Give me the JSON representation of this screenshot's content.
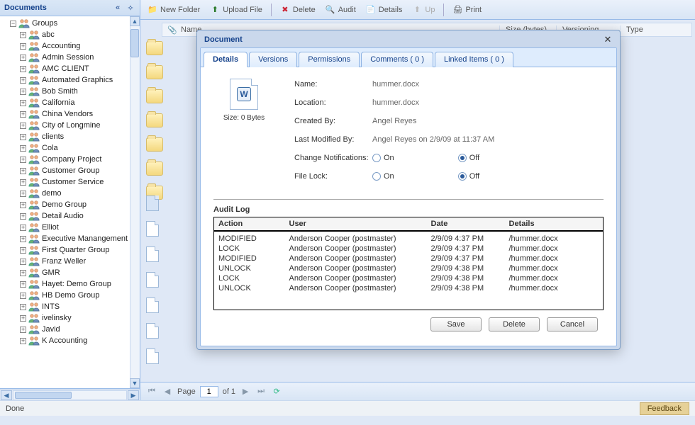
{
  "sidebar": {
    "title": "Documents",
    "root": "Groups",
    "items": [
      "abc",
      "Accounting",
      "Admin Session",
      "AMC CLIENT",
      "Automated Graphics",
      "Bob Smith",
      "California",
      "China Vendors",
      "City of Longmine",
      "clients",
      "Cola",
      "Company Project",
      "Customer Group",
      "Customer Service",
      "demo",
      "Demo Group",
      "Detail Audio",
      "Elliot",
      "Executive Manangement",
      "First Quarter Group",
      "Franz Weller",
      "GMR",
      "Hayet: Demo Group",
      "HB Demo Group",
      "INTS",
      "ivelinsky",
      "Javid",
      "K Accounting"
    ]
  },
  "toolbar": {
    "new_folder": "New Folder",
    "upload_file": "Upload File",
    "delete": "Delete",
    "audit": "Audit",
    "details": "Details",
    "up": "Up",
    "print": "Print"
  },
  "grid_headers": {
    "name": "Name",
    "size": "Size (bytes)",
    "versioning": "Versioning",
    "type": "Type"
  },
  "pager": {
    "page_label": "Page",
    "page_value": "1",
    "of_label": "of 1"
  },
  "status": {
    "done": "Done",
    "feedback": "Feedback"
  },
  "dialog": {
    "title": "Document",
    "tabs": {
      "details": "Details",
      "versions": "Versions",
      "permissions": "Permissions",
      "comments": "Comments ( 0 )",
      "linked": "Linked Items ( 0 )"
    },
    "size_label": "Size:",
    "size_value": "0 Bytes",
    "fields": {
      "name_label": "Name:",
      "name_value": "hummer.docx",
      "location_label": "Location:",
      "location_value": "hummer.docx",
      "created_label": "Created By:",
      "created_value": "Angel  Reyes",
      "modified_label": "Last Modified By:",
      "modified_value": "Angel  Reyes on 2/9/09 at 11:37 AM",
      "notify_label": "Change Notifications:",
      "lock_label": "File Lock:",
      "on": "On",
      "off": "Off"
    },
    "audit": {
      "heading": "Audit Log",
      "columns": {
        "action": "Action",
        "user": "User",
        "date": "Date",
        "details": "Details"
      },
      "rows": [
        {
          "action": "MODIFIED",
          "user": "Anderson Cooper (postmaster)",
          "date": "2/9/09 4:37 PM",
          "details": "/hummer.docx"
        },
        {
          "action": "LOCK",
          "user": "Anderson Cooper (postmaster)",
          "date": "2/9/09 4:37 PM",
          "details": "/hummer.docx"
        },
        {
          "action": "MODIFIED",
          "user": "Anderson Cooper (postmaster)",
          "date": "2/9/09 4:37 PM",
          "details": "/hummer.docx"
        },
        {
          "action": "UNLOCK",
          "user": "Anderson Cooper (postmaster)",
          "date": "2/9/09 4:38 PM",
          "details": "/hummer.docx"
        },
        {
          "action": "LOCK",
          "user": "Anderson Cooper (postmaster)",
          "date": "2/9/09 4:38 PM",
          "details": "/hummer.docx"
        },
        {
          "action": "UNLOCK",
          "user": "Anderson Cooper (postmaster)",
          "date": "2/9/09 4:38 PM",
          "details": "/hummer.docx"
        }
      ]
    },
    "buttons": {
      "save": "Save",
      "delete": "Delete",
      "cancel": "Cancel"
    }
  }
}
